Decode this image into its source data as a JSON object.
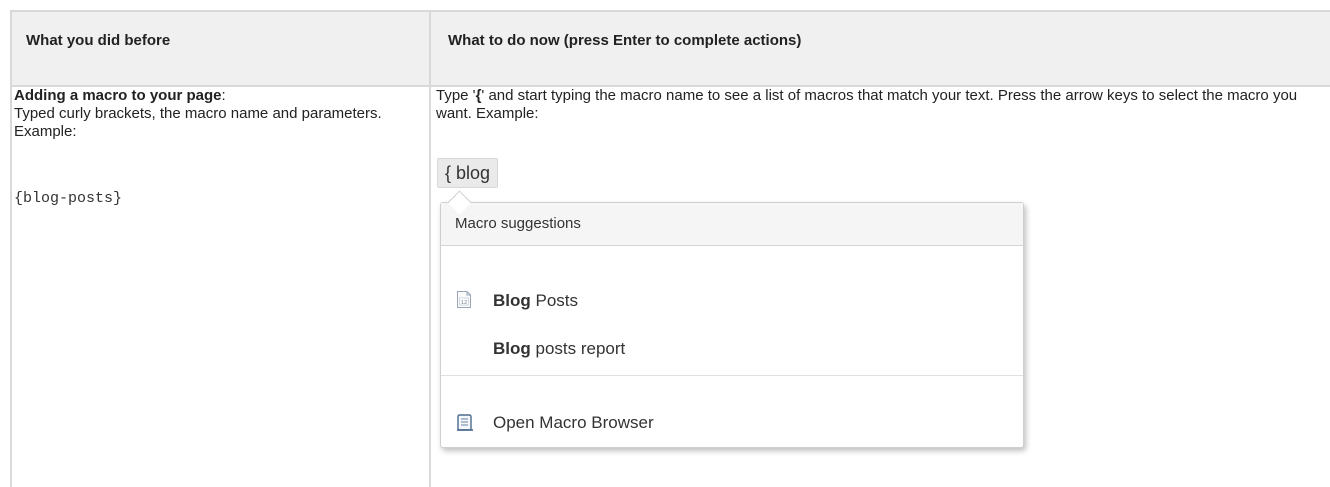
{
  "header": {
    "col1": "What you did before",
    "col2": "What to do now (press Enter to complete actions)"
  },
  "before": {
    "title": "Adding a macro to your page",
    "colon": ":",
    "text": "Typed curly brackets, the macro name and parameters. Example:",
    "example": "{blog-posts}"
  },
  "now": {
    "text_pre": "Type '",
    "brace": "{",
    "text_post": "' and start typing the macro name to see a list of macros that match your text. Press the arrow keys to select the macro you want. Example:",
    "typed_example": "{ blog",
    "popup": {
      "title": "Macro suggestions",
      "items": [
        {
          "bold": "Blog",
          "rest": " Posts",
          "icon": "calendar-icon"
        },
        {
          "bold": "Blog",
          "rest": " posts report",
          "icon": ""
        }
      ],
      "browser": {
        "label": "Open Macro Browser",
        "icon": "scroll-icon"
      }
    }
  }
}
